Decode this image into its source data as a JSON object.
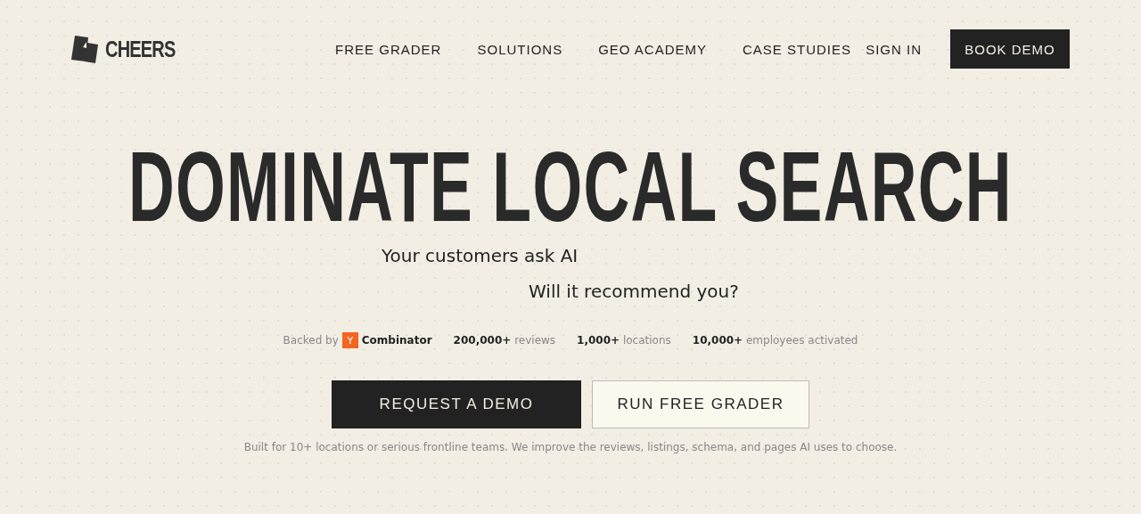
{
  "header": {
    "logo": "CHEERS",
    "nav": [
      {
        "label": "FREE GRADER"
      },
      {
        "label": "SOLUTIONS"
      },
      {
        "label": "GEO ACADEMY"
      },
      {
        "label": "CASE STUDIES"
      }
    ],
    "actions": [
      {
        "kind": "link",
        "label": "SIGN IN"
      },
      {
        "kind": "button",
        "label": "BOOK DEMO"
      }
    ]
  },
  "hero": {
    "title": "DOMINATE LOCAL SEARCH",
    "subtitle_lines": [
      "Your customers ask AI",
      "Will it recommend you?"
    ],
    "backers": {
      "prefix": "Backed by",
      "badge": "Y",
      "name": "Combinator"
    },
    "stats": [
      "**200,000+** reviews",
      "**1,000+** locations",
      "**10,000+** employees activated"
    ],
    "buttons": [
      {
        "kind": "primary",
        "label": "REQUEST A DEMO"
      },
      {
        "kind": "secondary",
        "label": "RUN FREE GRADER"
      }
    ],
    "note": "Built for 10+ locations or serious frontline teams. We improve the reviews, listings, schema, and pages AI uses to choose."
  }
}
